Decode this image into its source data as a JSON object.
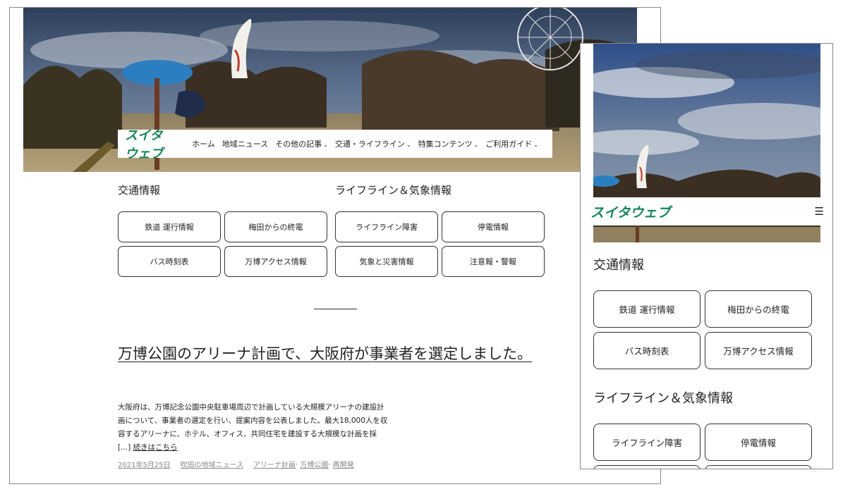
{
  "site": {
    "logo": "スイタウェブ"
  },
  "nav": [
    {
      "label": "ホーム",
      "dropdown": false
    },
    {
      "label": "地域ニュース",
      "dropdown": false
    },
    {
      "label": "その他の記事",
      "dropdown": true
    },
    {
      "label": "交通・ライフライン",
      "dropdown": true
    },
    {
      "label": "特集コンテンツ",
      "dropdown": true
    },
    {
      "label": "ご利用ガイド",
      "dropdown": true
    }
  ],
  "traffic": {
    "title": "交通情報",
    "buttons": [
      "鉄道 運行情報",
      "梅田からの終電",
      "バス時刻表",
      "万博アクセス情報"
    ]
  },
  "lifeline": {
    "title": "ライフライン＆気象情報",
    "buttons": [
      "ライフライン障害",
      "停電情報",
      "気象と災害情報",
      "注意報・警報"
    ]
  },
  "post": {
    "title": "万博公園のアリーナ計画で、大阪府が事業者を選定しました。",
    "excerpt_lines": [
      "大阪府は、万博記念公園中央駐車場周辺で計画している大規模アリーナの建設計",
      "画について、事業者の選定を行い、提案内容を公表しました。最大18,000人を収",
      "容するアリーナに、ホテル、オフィス、共同住宅を建設する大規模な計画を採"
    ],
    "excerpt_ellipsis": "[...]",
    "read_more": "続きはこちら",
    "date": "2021年5月25日",
    "category": "吹田の地域ニュース",
    "tags": [
      "アリーナ計画",
      "万博公園",
      "再開発"
    ]
  },
  "icons": {
    "chevron": "chevron-down-icon",
    "menu": "hamburger-menu-icon"
  },
  "colors": {
    "brand": "#16845a"
  }
}
